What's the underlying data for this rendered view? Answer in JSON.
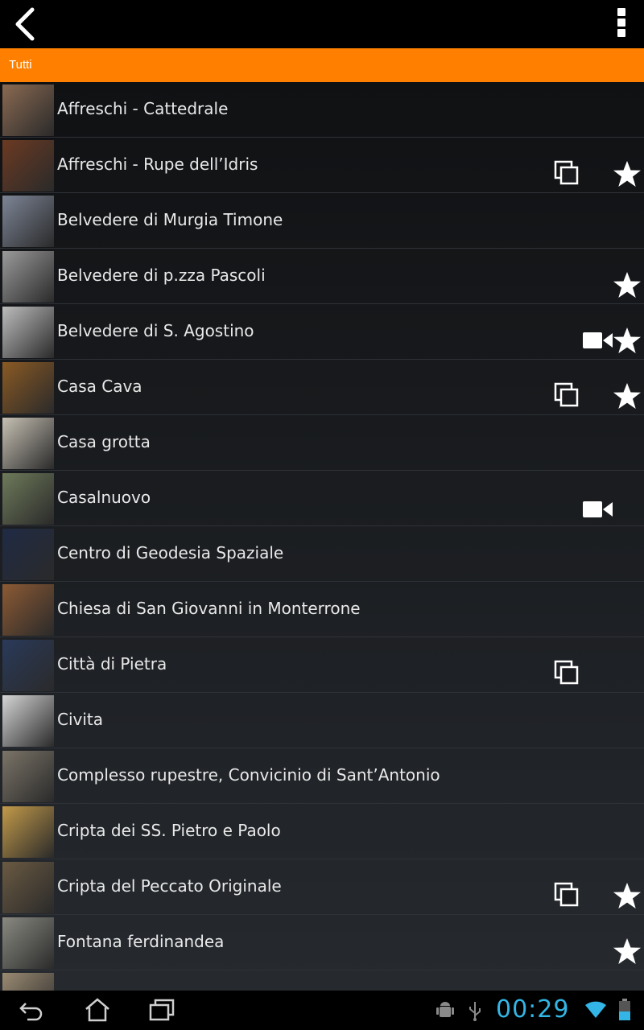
{
  "actionbar": {
    "back_icon": "back-chevron-icon",
    "menu_icon": "overflow-menu-icon"
  },
  "filter": {
    "label": "Tutti",
    "color": "#ff7f00"
  },
  "items": [
    {
      "title": "Affreschi - Cattedrale",
      "gallery": false,
      "video": false,
      "star": false,
      "thumb": "#8a6a52"
    },
    {
      "title": "Affreschi - Rupe dell’Idris",
      "gallery": true,
      "video": false,
      "star": true,
      "thumb": "#6b3a22"
    },
    {
      "title": "Belvedere di Murgia Timone",
      "gallery": false,
      "video": false,
      "star": false,
      "thumb": "#7d8596"
    },
    {
      "title": "Belvedere di p.zza Pascoli",
      "gallery": false,
      "video": false,
      "star": true,
      "thumb": "#9a9a9a"
    },
    {
      "title": "Belvedere di S. Agostino",
      "gallery": false,
      "video": true,
      "star": true,
      "thumb": "#bdbdbd"
    },
    {
      "title": "Casa Cava",
      "gallery": true,
      "video": false,
      "star": true,
      "thumb": "#8a5a24"
    },
    {
      "title": "Casa grotta",
      "gallery": false,
      "video": false,
      "star": false,
      "thumb": "#c7c1b4"
    },
    {
      "title": "Casalnuovo",
      "gallery": false,
      "video": true,
      "star": false,
      "thumb": "#6e7a5a"
    },
    {
      "title": "Centro di Geodesia Spaziale",
      "gallery": false,
      "video": false,
      "star": false,
      "thumb": "#1f2a44"
    },
    {
      "title": "Chiesa di San Giovanni in Monterrone",
      "gallery": false,
      "video": false,
      "star": false,
      "thumb": "#8c5a34"
    },
    {
      "title": "Città di Pietra",
      "gallery": true,
      "video": false,
      "star": false,
      "thumb": "#2a3a5a"
    },
    {
      "title": "Civita",
      "gallery": false,
      "video": false,
      "star": false,
      "thumb": "#d5d5d5"
    },
    {
      "title": "Complesso rupestre, Convicinio di Sant’Antonio",
      "gallery": false,
      "video": false,
      "star": false,
      "thumb": "#7b7468"
    },
    {
      "title": "Cripta dei SS. Pietro e Paolo",
      "gallery": false,
      "video": false,
      "star": false,
      "thumb": "#c29a4a"
    },
    {
      "title": "Cripta del Peccato Originale",
      "gallery": true,
      "video": false,
      "star": true,
      "thumb": "#6a5a42"
    },
    {
      "title": "Fontana ferdinandea",
      "gallery": false,
      "video": false,
      "star": true,
      "thumb": "#8a8a82"
    },
    {
      "title": "",
      "gallery": false,
      "video": false,
      "star": false,
      "thumb": "#9a8a72"
    }
  ],
  "statusbar": {
    "time": "00:29",
    "time_color": "#33b5e5"
  },
  "nav": {
    "back": "nav-back-icon",
    "home": "nav-home-icon",
    "recents": "nav-recents-icon"
  }
}
